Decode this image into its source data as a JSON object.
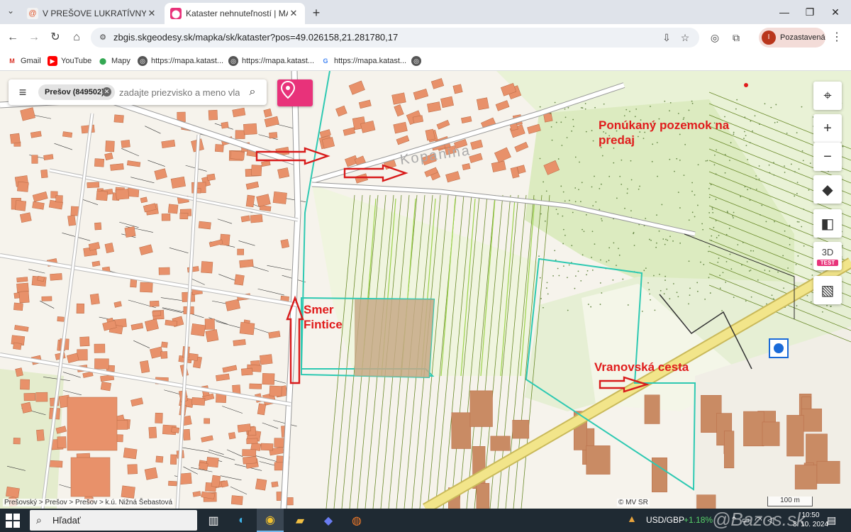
{
  "browser": {
    "tabs": [
      {
        "title": "V PREŠOVE LUKRATÍVNY STAVE",
        "active": false
      },
      {
        "title": "Kataster nehnuteľností | MAPKA",
        "active": true
      }
    ],
    "url": "zbgis.skgeodesy.sk/mapka/sk/kataster?pos=49.026158,21.281780,17",
    "profile": {
      "initial": "I",
      "label": "Pozastavená"
    },
    "bookmarks": [
      {
        "label": "Gmail",
        "icon": "gmail-icon"
      },
      {
        "label": "YouTube",
        "icon": "youtube-icon"
      },
      {
        "label": "Mapy",
        "icon": "maps-pin-icon"
      },
      {
        "label": "https://mapa.katast...",
        "icon": "globe-icon"
      },
      {
        "label": "https://mapa.katast...",
        "icon": "globe-icon"
      },
      {
        "label": "https://mapa.katast...",
        "icon": "google-icon"
      }
    ]
  },
  "map": {
    "search": {
      "chip": "Prešov (849502)",
      "placeholder": "zadajte priezvisko a meno vla"
    },
    "controls": {
      "label_3d": "3D",
      "badge_3d": "TEST"
    },
    "locality_label": "Kopanina",
    "annotations": {
      "offered_parcel": [
        "Ponúkaný pozemok na",
        "predaj"
      ],
      "direction": [
        "Smer",
        "Fintice"
      ],
      "road": "Vranovská cesta"
    },
    "breadcrumb": "Prešovský > Prešov > Prešov > k.ú. Nižná Šebastová",
    "copyright": "© MV SR",
    "scale": "100 m"
  },
  "taskbar": {
    "search_label": "Hľadať",
    "fx_pair": "USD/GBP",
    "fx_change": "+1.18%",
    "time": "10:50",
    "date": "3. 10. 2024",
    "watermark": "@Bazos.sk"
  },
  "colors": {
    "map_bg": "#f7f4ee",
    "building": "#e8916a",
    "highlight_outline": "#2ec9b2",
    "annotation_red": "#e01c1c",
    "green_area": "#d8eab8",
    "accent_pink": "#e8327a"
  }
}
